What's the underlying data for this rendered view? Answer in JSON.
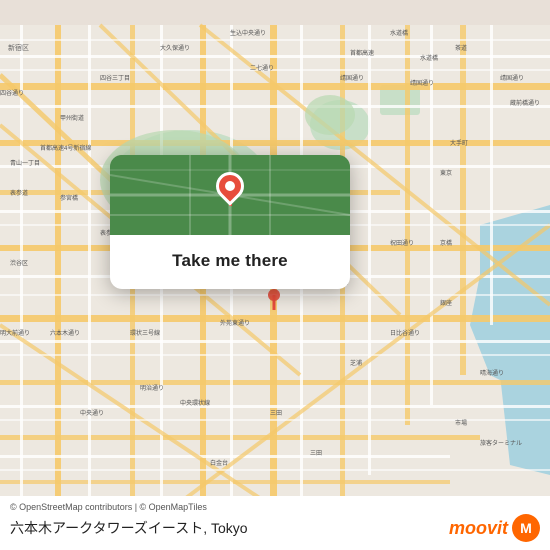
{
  "map": {
    "location": "Tokyo",
    "background_color": "#e8ddd0",
    "green_color": "#b8d4b0",
    "water_color": "#aad3df",
    "road_color": "#ffffff",
    "major_road_color": "#f5c96a"
  },
  "popup": {
    "button_label": "Take me there",
    "pin_color": "#e74c3c"
  },
  "bottom_bar": {
    "attribution": "© OpenStreetMap contributors | © OpenMapTiles",
    "location_name": "六本木アークタワーズイースト, Tokyo",
    "moovit_label": "moovit"
  }
}
